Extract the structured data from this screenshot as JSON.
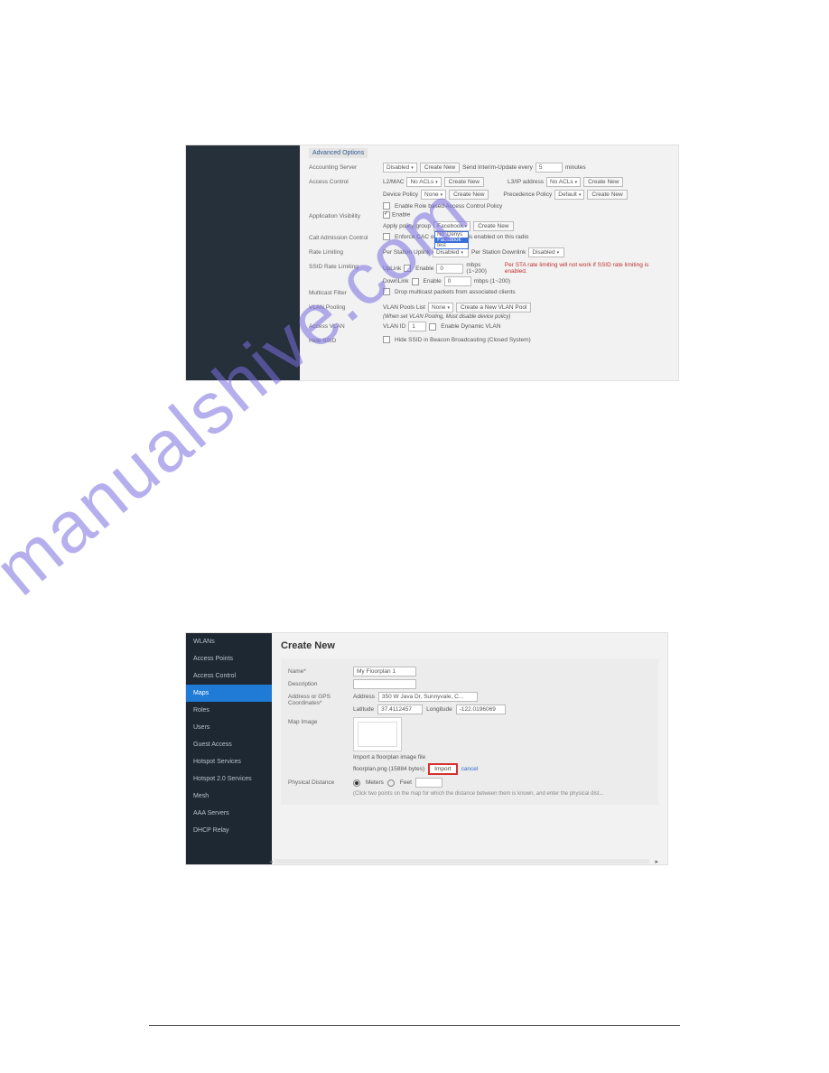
{
  "watermark": "manualshive.com",
  "shot1": {
    "adv_options": "Advanced Options",
    "rows": {
      "accounting_server": {
        "label": "Accounting Server",
        "disabled": "Disabled",
        "create": "Create New",
        "interim_lbl": "Send Interim-Update every",
        "interim_val": "5",
        "interim_unit": "minutes"
      },
      "access_control": {
        "label": "Access Control",
        "l2mac": "L2/MAC",
        "l2val": "No ACLs",
        "l2create": "Create New",
        "l3": "L3/IP address",
        "l3val": "No ACLs",
        "l3create": "Create New",
        "dev": "Device Policy",
        "devval": "None",
        "devcreate": "Create New",
        "prec": "Precedence Policy",
        "precval": "Default",
        "preccreate": "Create New",
        "role_cb": "Enable Role based Access Control Policy"
      },
      "app_vis": {
        "label": "Application Visibility",
        "enable": "Enable",
        "apply": "Apply policy group",
        "group": "Facebook",
        "create": "Create New",
        "dd0": "No_Denys",
        "dd1": "Facebook",
        "dd2": "test"
      },
      "cac": {
        "label": "Call Admission Control",
        "enforce": "Enforce CAC on",
        "suffix": "CAC is enabled on this radio"
      },
      "rate": {
        "label": "Rate Limiting",
        "ups": "Per Station Uplink",
        "upv": "Disabled",
        "dns": "Per Station Downlink",
        "dnv": "Disabled"
      },
      "ssid_rate": {
        "label": "SSID Rate Limiting",
        "up": "UpLink",
        "en": "Enable",
        "upval": "0",
        "upunit": "mbps (1~200)",
        "warn": "Per STA rate limiting will not work if SSID rate limiting is enabled.",
        "dn": "DownLink",
        "dnen": "Enable",
        "dnval": "0",
        "dnunit": "mbps (1~200)"
      },
      "multicast": {
        "label": "Multicast Filter",
        "txt": "Drop multicast packets from associated clients"
      },
      "vlan_pool": {
        "label": "VLAN Pooling",
        "poolslbl": "VLAN Pools List",
        "pools": "None",
        "create": "Create a New VLAN Pool",
        "note": "(When set VLAN Pooling, Must disable device policy)"
      },
      "access_vlan": {
        "label": "Access VLAN",
        "idlbl": "VLAN ID",
        "id": "1",
        "dyn": "Enable Dynamic VLAN"
      },
      "hide_ssid": {
        "label": "Hide SSID",
        "txt": "Hide SSID in Beacon Broadcasting (Closed System)"
      }
    }
  },
  "shot2": {
    "nav": [
      "WLANs",
      "Access Points",
      "Access Control",
      "Maps",
      "Roles",
      "Users",
      "Guest Access",
      "Hotspot Services",
      "Hotspot 2.0 Services",
      "Mesh",
      "AAA Servers",
      "DHCP Relay"
    ],
    "nav_active_index": 3,
    "title": "Create New",
    "name_lbl": "Name*",
    "name_val": "My Floorplan 1",
    "desc_lbl": "Description",
    "desc_val": "",
    "addr_lbl": "Address or GPS Coordinates*",
    "addr_txt": "Address",
    "addr_val": "350 W Java Dr, Sunnyvale, C...",
    "lat_lbl": "Latitude",
    "lat_val": "37.4112457",
    "lon_lbl": "Longitude",
    "lon_val": "-122.0196069",
    "map_lbl": "Map Image",
    "import_lbl": "Import a floorplan image file",
    "file_txt": "floorplan.png (15884 bytes)",
    "import_btn": "Import",
    "cancel": "cancel",
    "phys_lbl": "Physical Distance",
    "meters": "Meters",
    "feet": "Feet",
    "phys_hint": "(Click two points on the map for which the distance between them is known, and enter the physical dist..."
  }
}
